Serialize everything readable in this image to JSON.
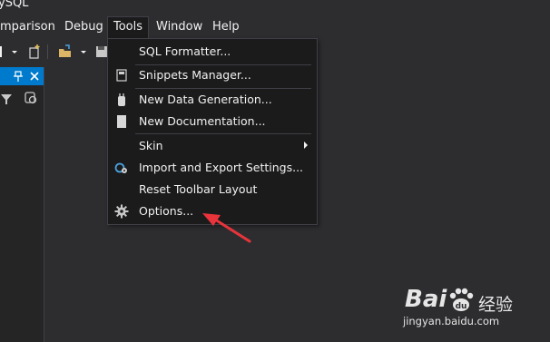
{
  "window": {
    "title": "ySQL"
  },
  "menubar": {
    "items": [
      {
        "label": "mparison"
      },
      {
        "label": "Debug"
      },
      {
        "label": "Tools"
      },
      {
        "label": "Window"
      },
      {
        "label": "Help"
      }
    ]
  },
  "tools_menu": {
    "items": [
      {
        "label": "SQL Formatter...",
        "icon": null
      },
      {
        "label": "Snippets Manager...",
        "icon": "snippets-icon"
      },
      {
        "label": "New Data Generation...",
        "icon": "data-generation-icon"
      },
      {
        "label": "New Documentation...",
        "icon": "documentation-icon"
      },
      {
        "label": "Skin",
        "icon": null,
        "submenu": true
      },
      {
        "label": "Import and Export Settings...",
        "icon": "import-export-settings-icon"
      },
      {
        "label": "Reset Toolbar Layout",
        "icon": null
      },
      {
        "label": "Options...",
        "icon": "gear-icon"
      }
    ]
  },
  "watermark": {
    "brand": "Bai",
    "brand2": "du",
    "jingyan": "经验",
    "url": "jingyan.baidu.com"
  },
  "colors": {
    "accent": "#007acc",
    "background": "#2d2d30",
    "menu_bg": "#1b1b1c",
    "annotation": "#e8343a"
  }
}
